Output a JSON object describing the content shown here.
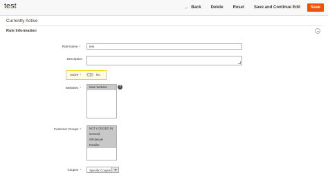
{
  "header": {
    "title": "test",
    "back_label": "Back",
    "delete_label": "Delete",
    "reset_label": "Reset",
    "save_continue_label": "Save and Continue Edit",
    "save_label": "Save"
  },
  "store_status": "Currently Active",
  "section": {
    "title": "Rule Information"
  },
  "form": {
    "rule_name": {
      "label": "Rule Name",
      "value": "test"
    },
    "description": {
      "label": "Description",
      "value": ""
    },
    "active": {
      "label": "Active",
      "state_text": "No",
      "enabled": false
    },
    "websites": {
      "label": "Websites",
      "options": [
        "Main Website"
      ],
      "selected": [
        "Main Website"
      ]
    },
    "customer_groups": {
      "label": "Customer Groups",
      "options": [
        "NOT LOGGED IN",
        "General",
        "Wholesale",
        "Retailer"
      ]
    },
    "coupon": {
      "label": "Coupon",
      "value": "Specific Coupon"
    }
  },
  "colors": {
    "accent": "#eb5202",
    "highlight_border": "#f1d600",
    "required": "#e22626"
  },
  "icons": {
    "back": "arrow-left-icon",
    "help": "question-mark-icon",
    "collapse": "collapse-circle-icon",
    "dropdown": "chevron-down-icon"
  }
}
